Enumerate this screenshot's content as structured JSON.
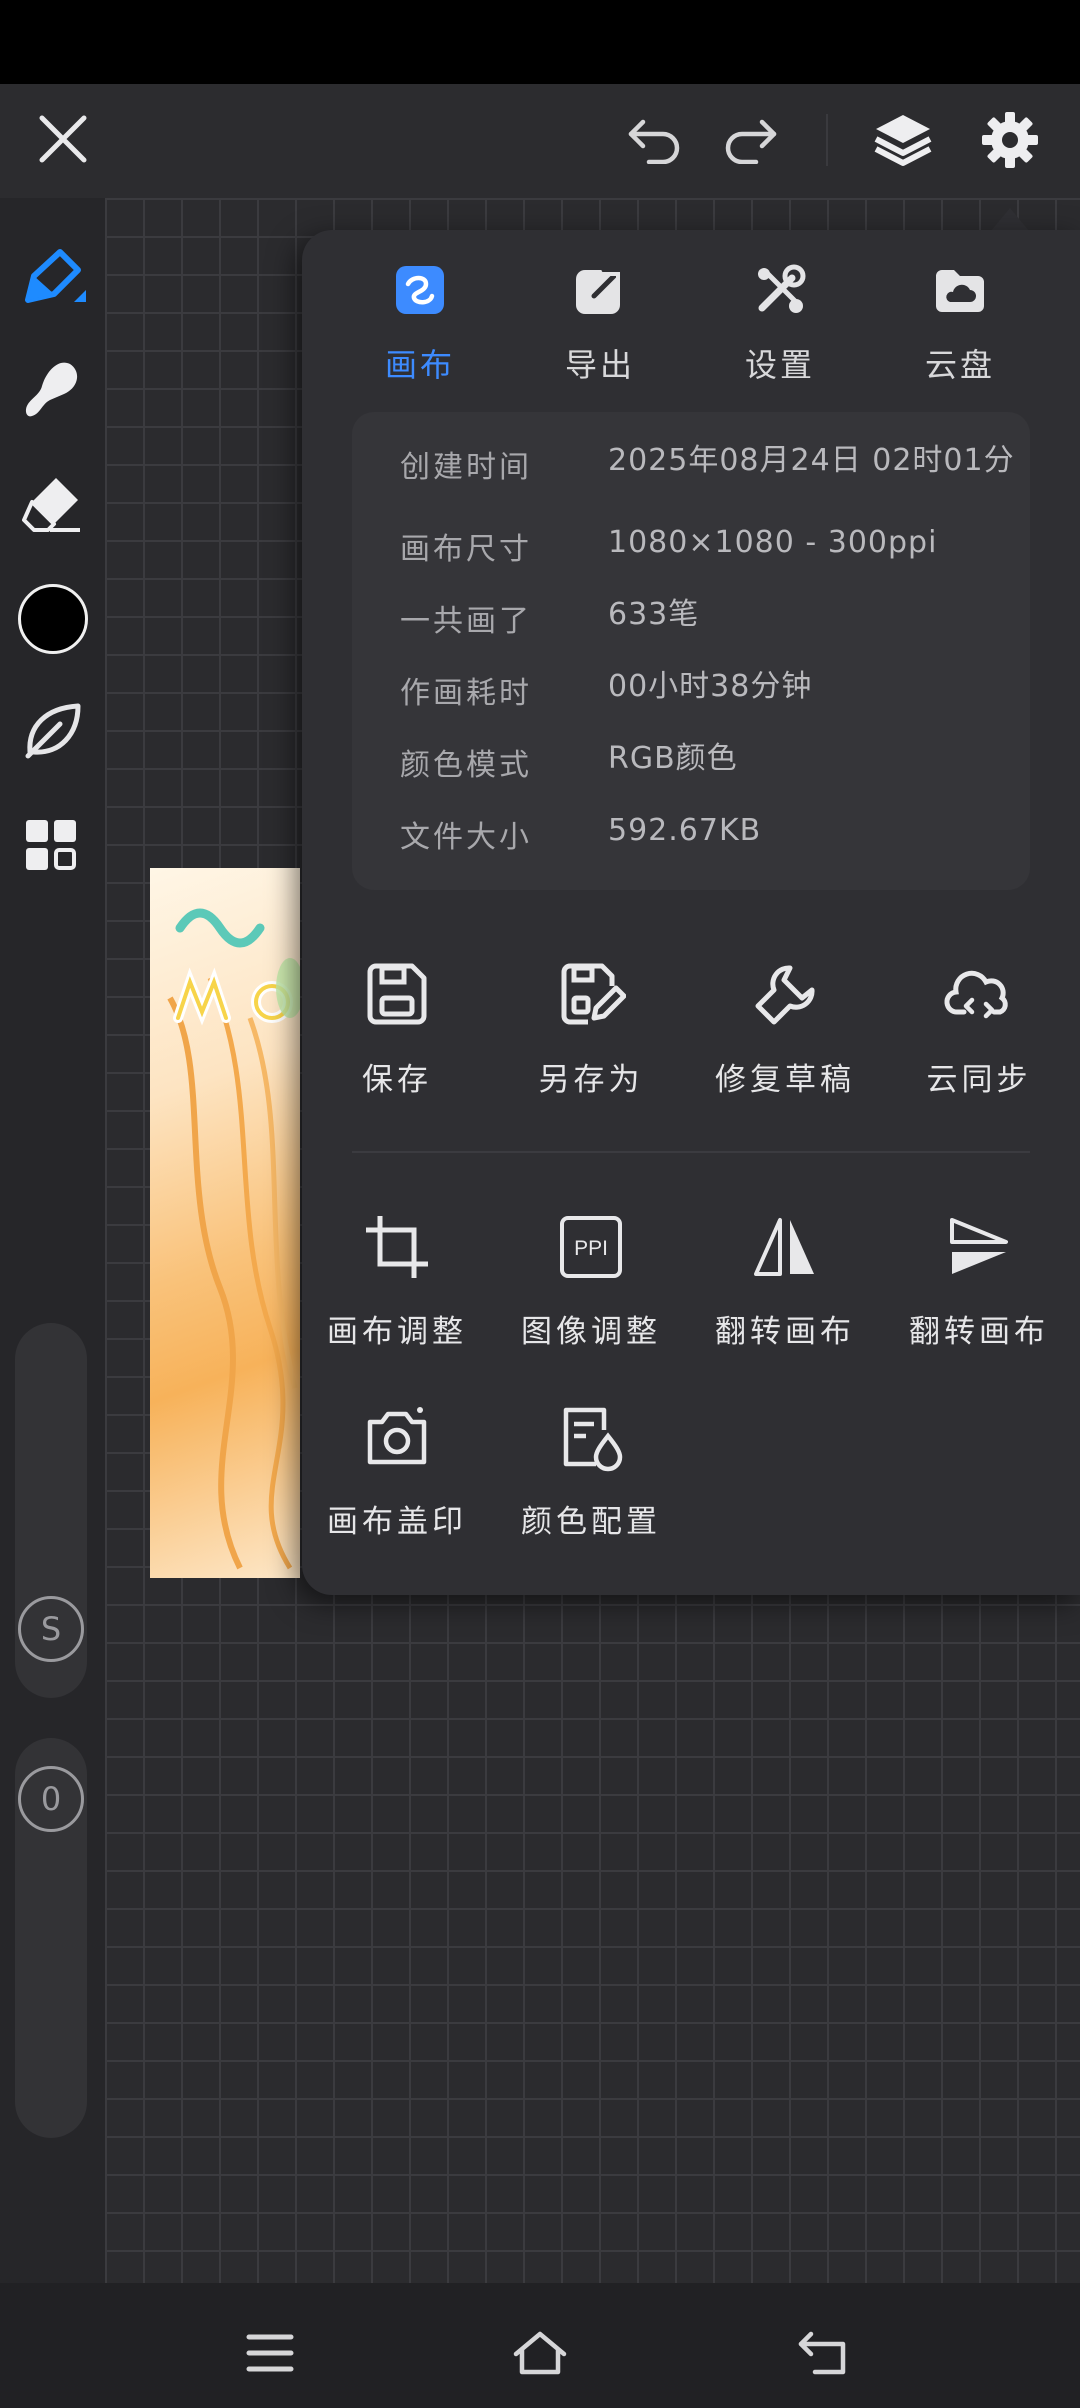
{
  "colors": {
    "accent": "#3d8bff",
    "panel": "#2f2f33",
    "background": "#2b2b2e"
  },
  "topbar": {
    "icons": [
      "close-icon",
      "undo-icon",
      "redo-icon",
      "layers-icon",
      "settings-gear-icon"
    ]
  },
  "sidebar": {
    "tools": [
      "pen-tool-icon",
      "smudge-brush-icon",
      "eraser-icon",
      "color-swatch",
      "leaf-brush-icon",
      "grid-panel-icon"
    ],
    "badges": {
      "s_label": "S",
      "zero_label": "0"
    }
  },
  "panel": {
    "tabs": [
      {
        "label": "画布",
        "icon": "canvas-tab-icon",
        "active": true
      },
      {
        "label": "导出",
        "icon": "export-icon",
        "active": false
      },
      {
        "label": "设置",
        "icon": "tools-icon",
        "active": false
      },
      {
        "label": "云盘",
        "icon": "cloud-drive-icon",
        "active": false
      }
    ],
    "info": [
      {
        "key": "创建时间",
        "value": "2025年08月24日 02时01分"
      },
      {
        "key": "画布尺寸",
        "value": "1080×1080 - 300ppi"
      },
      {
        "key": "一共画了",
        "value": "633笔"
      },
      {
        "key": "作画耗时",
        "value": "00小时38分钟"
      },
      {
        "key": "颜色模式",
        "value": "RGB颜色"
      },
      {
        "key": "文件大小",
        "value": "592.67KB"
      }
    ],
    "actions_row1": [
      {
        "label": "保存",
        "icon": "save-icon"
      },
      {
        "label": "另存为",
        "icon": "save-as-icon"
      },
      {
        "label": "修复草稿",
        "icon": "wrench-icon"
      },
      {
        "label": "云同步",
        "icon": "cloud-sync-icon"
      }
    ],
    "actions_row2": [
      {
        "label": "画布调整",
        "icon": "crop-icon"
      },
      {
        "label": "图像调整",
        "icon": "ppi-icon",
        "icon_text": "PPI"
      },
      {
        "label": "翻转画布",
        "icon": "flip-horizontal-icon"
      },
      {
        "label": "翻转画布",
        "icon": "flip-vertical-icon"
      }
    ],
    "actions_row3": [
      {
        "label": "画布盖印",
        "icon": "camera-icon"
      },
      {
        "label": "颜色配置",
        "icon": "color-profile-icon"
      }
    ]
  },
  "navbar": {
    "icons": [
      "menu-icon",
      "home-icon",
      "back-icon"
    ]
  }
}
